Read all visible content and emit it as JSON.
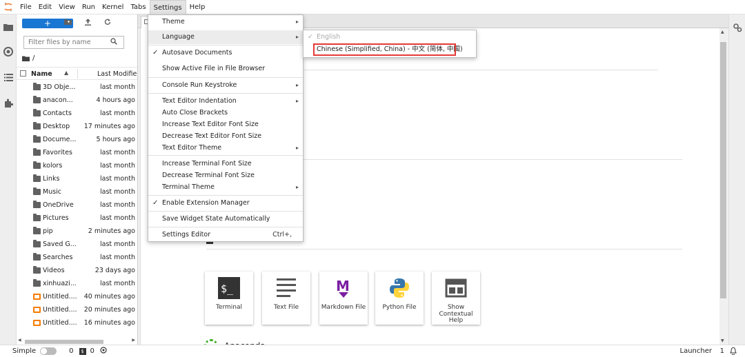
{
  "menubar": {
    "items": [
      "File",
      "Edit",
      "View",
      "Run",
      "Kernel",
      "Tabs",
      "Settings",
      "Help"
    ],
    "active_index": 6
  },
  "filebrowser": {
    "new_label": "+",
    "filter_placeholder": "Filter files by name",
    "breadcrumb": "/",
    "col_name": "Name",
    "col_modified": "Last Modified",
    "files": [
      {
        "name": "3D Obje...",
        "modified": "last month",
        "type": "folder"
      },
      {
        "name": "anacon...",
        "modified": "4 hours ago",
        "type": "folder"
      },
      {
        "name": "Contacts",
        "modified": "last month",
        "type": "folder"
      },
      {
        "name": "Desktop",
        "modified": "17 minutes ago",
        "type": "folder"
      },
      {
        "name": "Docume...",
        "modified": "5 hours ago",
        "type": "folder"
      },
      {
        "name": "Favorites",
        "modified": "last month",
        "type": "folder"
      },
      {
        "name": "kolors",
        "modified": "last month",
        "type": "folder"
      },
      {
        "name": "Links",
        "modified": "last month",
        "type": "folder"
      },
      {
        "name": "Music",
        "modified": "last month",
        "type": "folder"
      },
      {
        "name": "OneDrive",
        "modified": "last month",
        "type": "folder"
      },
      {
        "name": "Pictures",
        "modified": "last month",
        "type": "folder"
      },
      {
        "name": "pip",
        "modified": "2 minutes ago",
        "type": "folder"
      },
      {
        "name": "Saved G...",
        "modified": "last month",
        "type": "folder"
      },
      {
        "name": "Searches",
        "modified": "last month",
        "type": "folder"
      },
      {
        "name": "Videos",
        "modified": "23 days ago",
        "type": "folder"
      },
      {
        "name": "xinhuazi...",
        "modified": "last month",
        "type": "folder"
      },
      {
        "name": "Untitled....",
        "modified": "40 minutes ago",
        "type": "notebook"
      },
      {
        "name": "Untitled....",
        "modified": "20 minutes ago",
        "type": "notebook"
      },
      {
        "name": "Untitled....",
        "modified": "16 minutes ago",
        "type": "notebook"
      }
    ]
  },
  "settings_menu": {
    "items": [
      {
        "label": "Theme",
        "submenu": true,
        "checked": false
      },
      {
        "label": "Language",
        "submenu": true,
        "checked": false,
        "active": true
      },
      {
        "label": "Autosave Documents",
        "submenu": false,
        "checked": true
      },
      {
        "label": "Show Active File in File Browser",
        "submenu": false,
        "checked": false
      },
      {
        "label": "Console Run Keystroke",
        "submenu": true,
        "checked": false
      },
      {
        "label": "Text Editor Indentation",
        "submenu": true,
        "checked": false
      },
      {
        "label": "Auto Close Brackets",
        "submenu": false,
        "checked": false
      },
      {
        "label": "Increase Text Editor Font Size",
        "submenu": false,
        "checked": false
      },
      {
        "label": "Decrease Text Editor Font Size",
        "submenu": false,
        "checked": false
      },
      {
        "label": "Text Editor Theme",
        "submenu": true,
        "checked": false
      },
      {
        "label": "Increase Terminal Font Size",
        "submenu": false,
        "checked": false
      },
      {
        "label": "Decrease Terminal Font Size",
        "submenu": false,
        "checked": false
      },
      {
        "label": "Terminal Theme",
        "submenu": true,
        "checked": false
      },
      {
        "label": "Enable Extension Manager",
        "submenu": false,
        "checked": true
      },
      {
        "label": "Save Widget State Automatically",
        "submenu": false,
        "checked": false
      },
      {
        "label": "Settings Editor",
        "submenu": false,
        "checked": false,
        "shortcut": "Ctrl+,"
      }
    ]
  },
  "language_submenu": {
    "items": [
      {
        "label": "English",
        "checked": true,
        "disabled": true
      },
      {
        "label": "Chinese (Simplified, China) - 中文 (简体, 中国)",
        "checked": false,
        "highlighted": true
      }
    ]
  },
  "launcher": {
    "cards": [
      {
        "label": "Terminal",
        "icon": "terminal-icon"
      },
      {
        "label": "Text File",
        "icon": "text-file-icon"
      },
      {
        "label": "Markdown File",
        "icon": "markdown-icon"
      },
      {
        "label": "Python File",
        "icon": "python-icon"
      },
      {
        "label": "Show\nContextual\nHelp",
        "icon": "contextual-help-icon"
      }
    ],
    "section_label": "Anaconda"
  },
  "statusbar": {
    "mode": "Simple",
    "count1": "0",
    "count2": "0",
    "right_label": "Launcher",
    "right_count": "1"
  },
  "colors": {
    "accent": "#1976d2",
    "highlight_box": "#e53935",
    "notebook": "#f57c00",
    "markdown": "#7b1fa2"
  }
}
